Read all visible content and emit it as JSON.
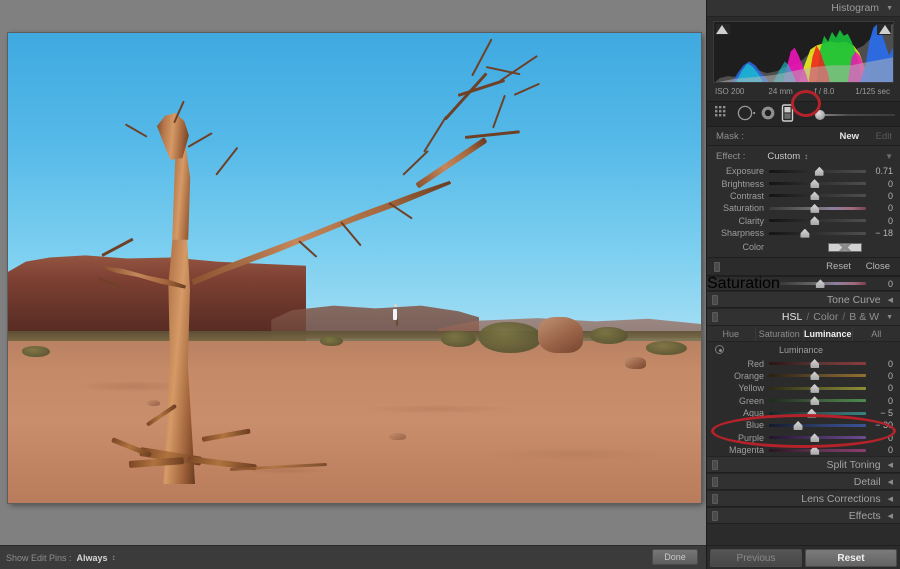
{
  "histogram": {
    "panel_title": "Histogram",
    "meta": {
      "iso": "ISO 200",
      "focal": "24 mm",
      "aperture": "f / 8.0",
      "shutter": "1/125 sec"
    }
  },
  "tools": {
    "crop_icon": "crop-overlay-icon",
    "spot_icon": "spot-removal-circle-icon",
    "redeye_icon": "red-eye-icon",
    "graduated_icon": "graduated-filter-icon",
    "brush_icon": "adjustment-brush-icon",
    "selected_tool": "graduated-filter"
  },
  "mask": {
    "label": "Mask :",
    "new_label": "New",
    "edit_label": "Edit"
  },
  "effect": {
    "label": "Effect :",
    "value": "Custom",
    "sliders": [
      {
        "name": "Exposure",
        "value": "0.71",
        "pos": 52,
        "grad": ""
      },
      {
        "name": "Brightness",
        "value": "0",
        "pos": 47,
        "grad": ""
      },
      {
        "name": "Contrast",
        "value": "0",
        "pos": 47,
        "grad": ""
      },
      {
        "name": "Saturation",
        "value": "0",
        "pos": 47,
        "grad": "grad-sat"
      },
      {
        "name": "Clarity",
        "value": "0",
        "pos": 47,
        "grad": ""
      },
      {
        "name": "Sharpness",
        "value": "− 18",
        "pos": 37,
        "grad": ""
      }
    ],
    "color_label": "Color",
    "reset_label": "Reset",
    "close_label": "Close"
  },
  "saturation_strip": {
    "name": "Saturation",
    "value": "0",
    "pos": 47
  },
  "tone_curve": {
    "title": "Tone Curve"
  },
  "hsl": {
    "title_parts": [
      "HSL",
      "/",
      "Color",
      "/",
      "B & W"
    ],
    "tabs": [
      {
        "label": "Hue",
        "active": false
      },
      {
        "label": "Saturation",
        "active": false
      },
      {
        "label": "Luminance",
        "active": true
      },
      {
        "label": "All",
        "active": false
      }
    ],
    "section_title": "Luminance",
    "sliders": [
      {
        "name": "Red",
        "value": "0",
        "pos": 47,
        "grad": "grad-red"
      },
      {
        "name": "Orange",
        "value": "0",
        "pos": 47,
        "grad": "grad-orange"
      },
      {
        "name": "Yellow",
        "value": "0",
        "pos": 47,
        "grad": "grad-yellow"
      },
      {
        "name": "Green",
        "value": "0",
        "pos": 47,
        "grad": "grad-green"
      },
      {
        "name": "Aqua",
        "value": "− 5",
        "pos": 44,
        "grad": "grad-aqua"
      },
      {
        "name": "Blue",
        "value": "− 30",
        "pos": 30,
        "grad": "grad-blue"
      },
      {
        "name": "Purple",
        "value": "0",
        "pos": 47,
        "grad": "grad-purple"
      },
      {
        "name": "Magenta",
        "value": "0",
        "pos": 47,
        "grad": "grad-magenta"
      }
    ]
  },
  "collapsed_panels": [
    {
      "title": "Split Toning"
    },
    {
      "title": "Detail"
    },
    {
      "title": "Lens Corrections"
    },
    {
      "title": "Effects"
    }
  ],
  "right_footer": {
    "previous_label": "Previous",
    "reset_label": "Reset"
  },
  "bottom_bar": {
    "show_edit_pins_label": "Show Edit Pins :",
    "show_edit_pins_value": "Always",
    "done_label": "Done"
  },
  "colors": {
    "panel_bg": "#2b2b2b",
    "canvas_bg": "#808080",
    "annotation_red": "#b5222a",
    "accent_text": "#f0f0f0",
    "sky_blue": "#55b9e8",
    "desert_sand": "#c58a67",
    "mesa_red": "#7e4133"
  },
  "photo": {
    "description": "Dead weathered tree in red desert with mesa and blue sky",
    "person_present": true
  }
}
